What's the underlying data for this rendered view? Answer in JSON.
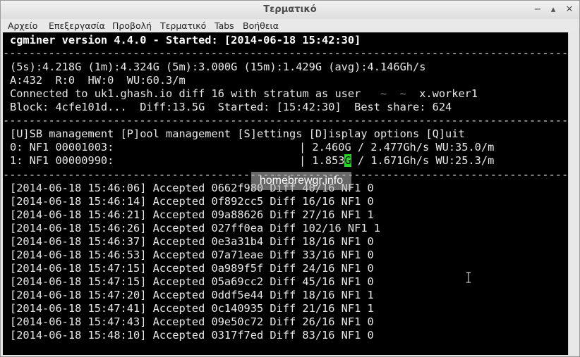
{
  "window": {
    "title": "Τερματικό",
    "controls": {
      "minimize": "−",
      "maximize": "▴",
      "close": "✕"
    }
  },
  "menubar": {
    "items": [
      {
        "label": "Αρχείο"
      },
      {
        "label": "Επεξεργασία"
      },
      {
        "label": "Προβολή"
      },
      {
        "label": "Τερματικό"
      },
      {
        "label": "Tabs"
      },
      {
        "label": "Βοήθεια"
      }
    ]
  },
  "terminal": {
    "header": "cgminer version 4.4.0 - Started: [2014-06-18 15:42:30]",
    "separator": "--------------------------------------------------------------------------------------------",
    "stats": {
      "rates": "(5s):4.218G (1m):4.324G (5m):3.000G (15m):1.429G (avg):4.146Gh/s",
      "counters": "A:432  R:0  HW:0  WU:60.3/m",
      "connection_prefix": "Connected to uk1.ghash.io diff 16 with stratum as user ",
      "connection_suffix": "x.worker1",
      "block": "Block: 4cfe101d...  Diff:13.5G  Started: [15:42:30]  Best share: 624"
    },
    "menu_line": "[U]SB management [P]ool management [S]ettings [D]isplay options [Q]uit",
    "devices": [
      {
        "label": "0: NF1 00001003:",
        "stats": "| 2.460G / 2.477Gh/s WU:35.0/m"
      },
      {
        "label": "1: NF1 00000990:",
        "stats_pre": "| 1.853",
        "stats_hl": "G",
        "stats_post": " / 1.671Gh/s WU:25.3/m"
      }
    ],
    "log": [
      "[2014-06-18 15:46:06] Accepted 0662f980 Diff 40/16 NF1 0",
      "[2014-06-18 15:46:14] Accepted 0f892cc5 Diff 16/16 NF1 0",
      "[2014-06-18 15:46:21] Accepted 09a88626 Diff 27/16 NF1 1",
      "[2014-06-18 15:46:26] Accepted 027ff0ea Diff 102/16 NF1 1",
      "[2014-06-18 15:46:37] Accepted 0e3a31b4 Diff 18/16 NF1 0",
      "[2014-06-18 15:46:53] Accepted 07a71eae Diff 33/16 NF1 0",
      "[2014-06-18 15:47:15] Accepted 0a989f5f Diff 24/16 NF1 0",
      "[2014-06-18 15:47:15] Accepted 05a69cc2 Diff 45/16 NF1 0",
      "[2014-06-18 15:47:20] Accepted 0ddf5e44 Diff 18/16 NF1 1",
      "[2014-06-18 15:47:41] Accepted 0c140935 Diff 21/16 NF1 1",
      "[2014-06-18 15:47:43] Accepted 09e50c72 Diff 26/16 NF1 0",
      "[2014-06-18 15:48:10] Accepted 0317f7ed Diff 83/16 NF1 0"
    ]
  },
  "watermark": "homebrewgr.info",
  "colors": {
    "terminal_bg": "#000000",
    "terminal_fg": "#e8e8e8",
    "highlight": "#2ad12a"
  }
}
